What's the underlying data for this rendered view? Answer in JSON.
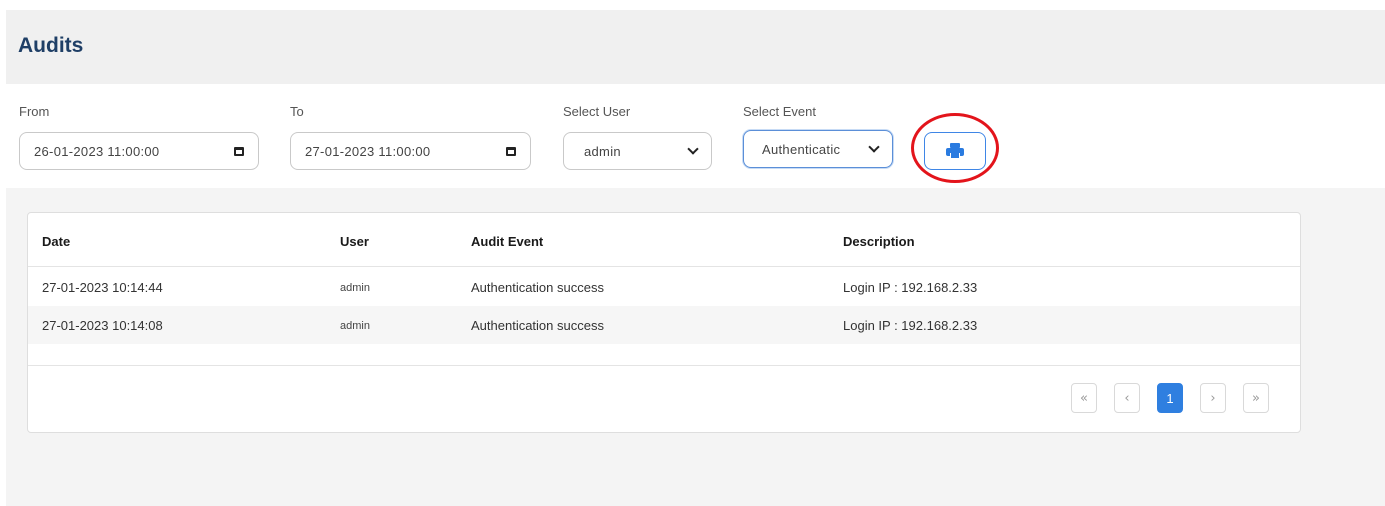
{
  "page": {
    "title": "Audits"
  },
  "filters": {
    "from": {
      "label": "From",
      "value": "26-01-2023 11:00:00"
    },
    "to": {
      "label": "To",
      "value": "27-01-2023 11:00:00"
    },
    "user": {
      "label": "Select User",
      "value": "admin"
    },
    "event": {
      "label": "Select Event",
      "value": "Authenticatic"
    }
  },
  "table": {
    "columns": [
      "Date",
      "User",
      "Audit Event",
      "Description"
    ],
    "rows": [
      {
        "date": "27-01-2023 10:14:44",
        "user": "admin",
        "event": "Authentication success",
        "description": "Login IP : 192.168.2.33"
      },
      {
        "date": "27-01-2023 10:14:08",
        "user": "admin",
        "event": "Authentication success",
        "description": "Login IP : 192.168.2.33"
      }
    ]
  },
  "pagination": {
    "first": "«",
    "prev": "‹",
    "current": "1",
    "next": "›",
    "last": "»"
  },
  "colors": {
    "accent": "#2f7fe0",
    "title": "#1f3f66",
    "highlight": "#e3141b"
  },
  "icons": {
    "date_picker": "calendar-icon",
    "dropdown": "chevron-down-icon",
    "print": "printer-icon"
  }
}
